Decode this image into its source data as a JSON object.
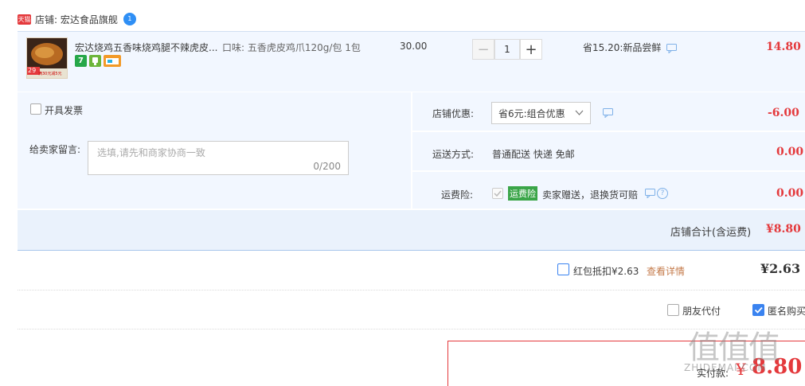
{
  "shop": {
    "name_label": "店铺: 宏达食品旗舰",
    "tmall_badge": "天猫",
    "chat_badge": "1"
  },
  "item": {
    "title": "宏达烧鸡五香味烧鸡腿不辣虎皮...",
    "sku": "口味: 五香虎皮鸡爪120g/包 1包",
    "unit_price": "30.00",
    "quantity": "1",
    "minus": "−",
    "plus": "+",
    "discount_note": "省15.20:新品尝鲜",
    "subtotal": "14.80",
    "thumb_text": "29",
    "thumb_promo": "满30元减5元",
    "badge_seven": "7"
  },
  "invoice": {
    "label": "开具发票"
  },
  "message": {
    "label": "给卖家留言:",
    "placeholder": "选填,请先和商家协商一致",
    "counter": "0/200"
  },
  "shop_discount": {
    "label": "店铺优惠:",
    "selected": "省6元:组合优惠",
    "amount": "-6.00"
  },
  "shipping": {
    "label": "运送方式:",
    "value": "普通配送 快递 免邮",
    "amount": "0.00"
  },
  "insurance": {
    "label": "运费险:",
    "tag": "运费险",
    "desc": "卖家赠送，退换货可赔",
    "amount": "0.00"
  },
  "shop_total": {
    "label": "店铺合计(含运费)",
    "amount": "¥8.80"
  },
  "redpacket": {
    "label": "红包抵扣¥2.63",
    "link": "查看详情",
    "amount": "¥2.63"
  },
  "options": {
    "friend_pay": "朋友代付",
    "anonymous": "匿名购买"
  },
  "total": {
    "label": "实付款:",
    "currency": "¥",
    "amount": "8.80",
    "address_snip": "zhi"
  },
  "watermark": {
    "text": "值值值",
    "sub": "ZHIDEMAI.COM"
  },
  "colors": {
    "accent": "#e4393c",
    "blue": "#3a83f0",
    "band": "#f2f7ff"
  }
}
